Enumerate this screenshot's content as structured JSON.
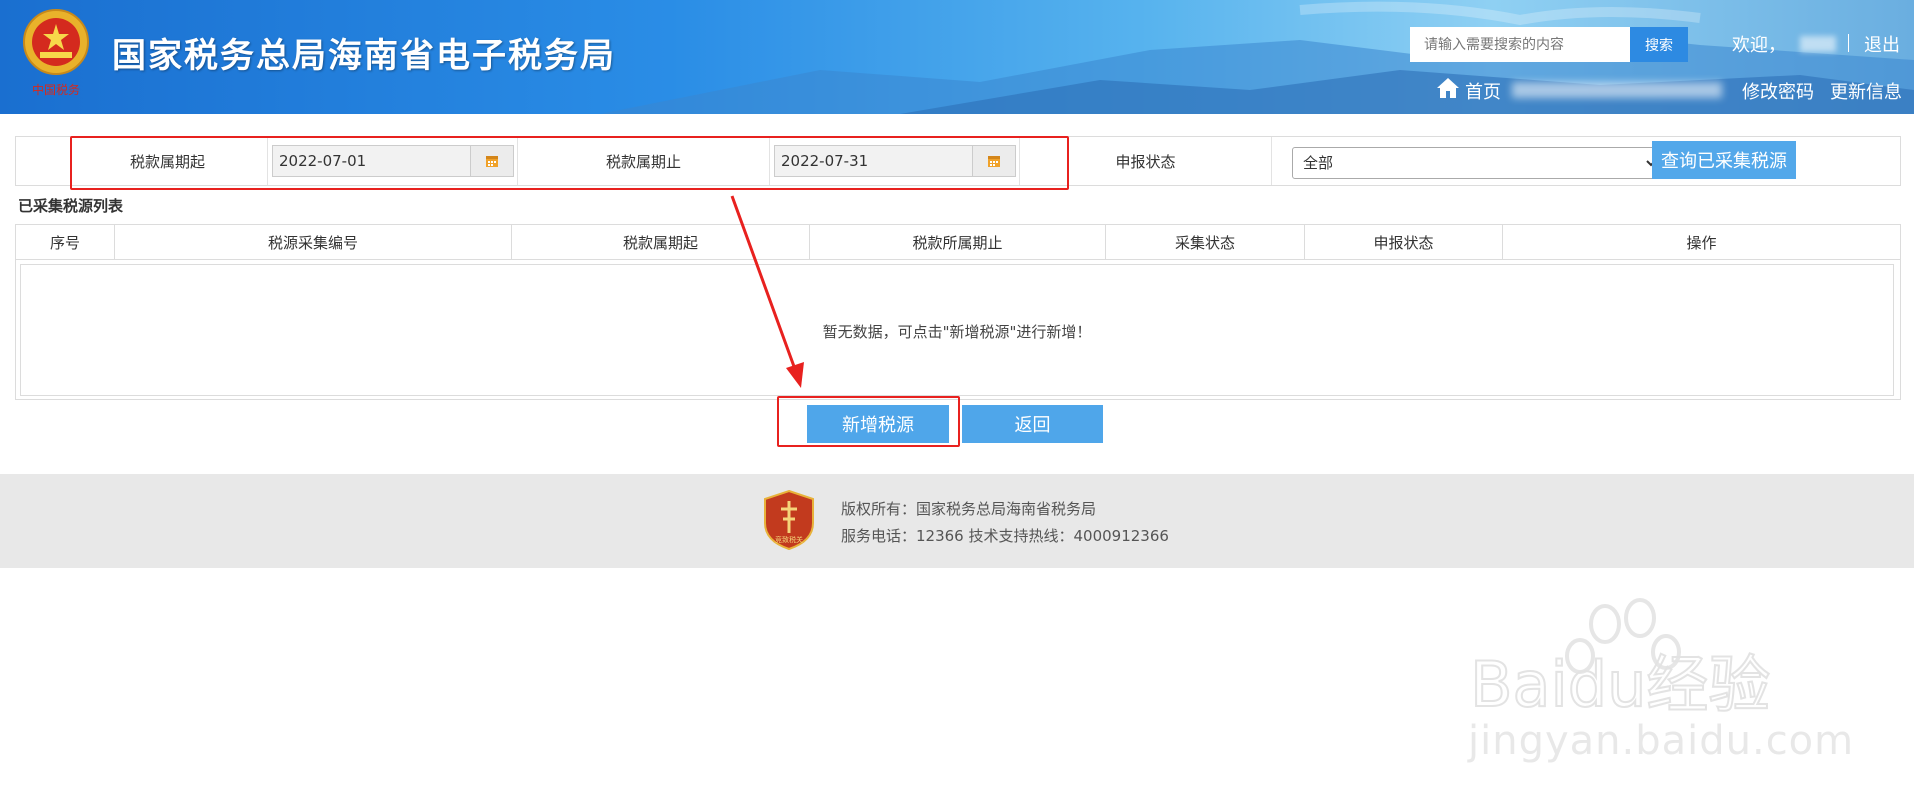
{
  "header": {
    "site_title": "国家税务总局海南省电子税务局",
    "search_placeholder": "请输入需要搜索的内容",
    "search_button": "搜索",
    "welcome": "欢迎，",
    "logout": "退出",
    "home": "首页",
    "change_password": "修改密码",
    "update_info": "更新信息",
    "emblem_text": "中国税务"
  },
  "filters": {
    "start_label": "税款属期起",
    "start_value": "2022-07-01",
    "end_label": "税款属期止",
    "end_value": "2022-07-31",
    "status_label": "申报状态",
    "status_selected": "全部",
    "query_button": "查询已采集税源"
  },
  "list": {
    "title": "已采集税源列表",
    "columns": [
      "序号",
      "税源采集编号",
      "税款属期起",
      "税款所属期止",
      "采集状态",
      "申报状态",
      "操作"
    ],
    "empty_message": "暂无数据，可点击\"新增税源\"进行新增！"
  },
  "actions": {
    "add_button": "新增税源",
    "back_button": "返回"
  },
  "footer": {
    "copyright": "版权所有：国家税务总局海南省税务局",
    "contact": "服务电话：12366 技术支持热线：4000912366",
    "badge_text": "竞致税关"
  },
  "watermark": {
    "logo_text": "Baidu经验",
    "url_text": "jingyan.baidu.com"
  },
  "colors": {
    "header_blue": "#1a6fd0",
    "button_blue": "#4fa6ea",
    "highlight_red": "#e8211f",
    "footer_bg": "#e8e8e8"
  }
}
